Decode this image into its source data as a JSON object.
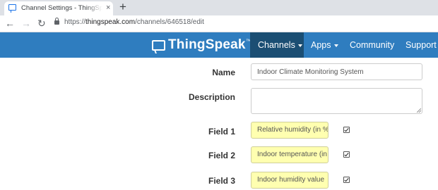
{
  "browser": {
    "tab_title": "Channel Settings - ThingSpeak IoT",
    "tab_close": "×",
    "new_tab": "+",
    "url_host": "thingspeak.com",
    "url_prefix": "https://",
    "url_path": "/channels/646518/edit"
  },
  "navbar": {
    "brand": "ThingSpeak",
    "brand_tm": "™",
    "items": [
      {
        "label": "Channels",
        "active": true,
        "dropdown": true
      },
      {
        "label": "Apps",
        "active": false,
        "dropdown": true
      },
      {
        "label": "Community",
        "active": false,
        "dropdown": false
      },
      {
        "label": "Support",
        "active": false,
        "dropdown": true
      }
    ],
    "colors": {
      "bar": "#2f7dbf",
      "active": "#1b4e73"
    }
  },
  "form": {
    "name": {
      "label": "Name",
      "value": "Indoor Climate Monitoring System"
    },
    "description": {
      "label": "Description",
      "value": ""
    },
    "fields": [
      {
        "label": "Field 1",
        "value": "Relative humidity (in %)",
        "checked": true
      },
      {
        "label": "Field 2",
        "value": "Indoor temperature (in °C)",
        "checked": true
      },
      {
        "label": "Field 3",
        "value": "Indoor humidity value",
        "checked": true
      }
    ],
    "field_input_color": "#ffffb0"
  }
}
